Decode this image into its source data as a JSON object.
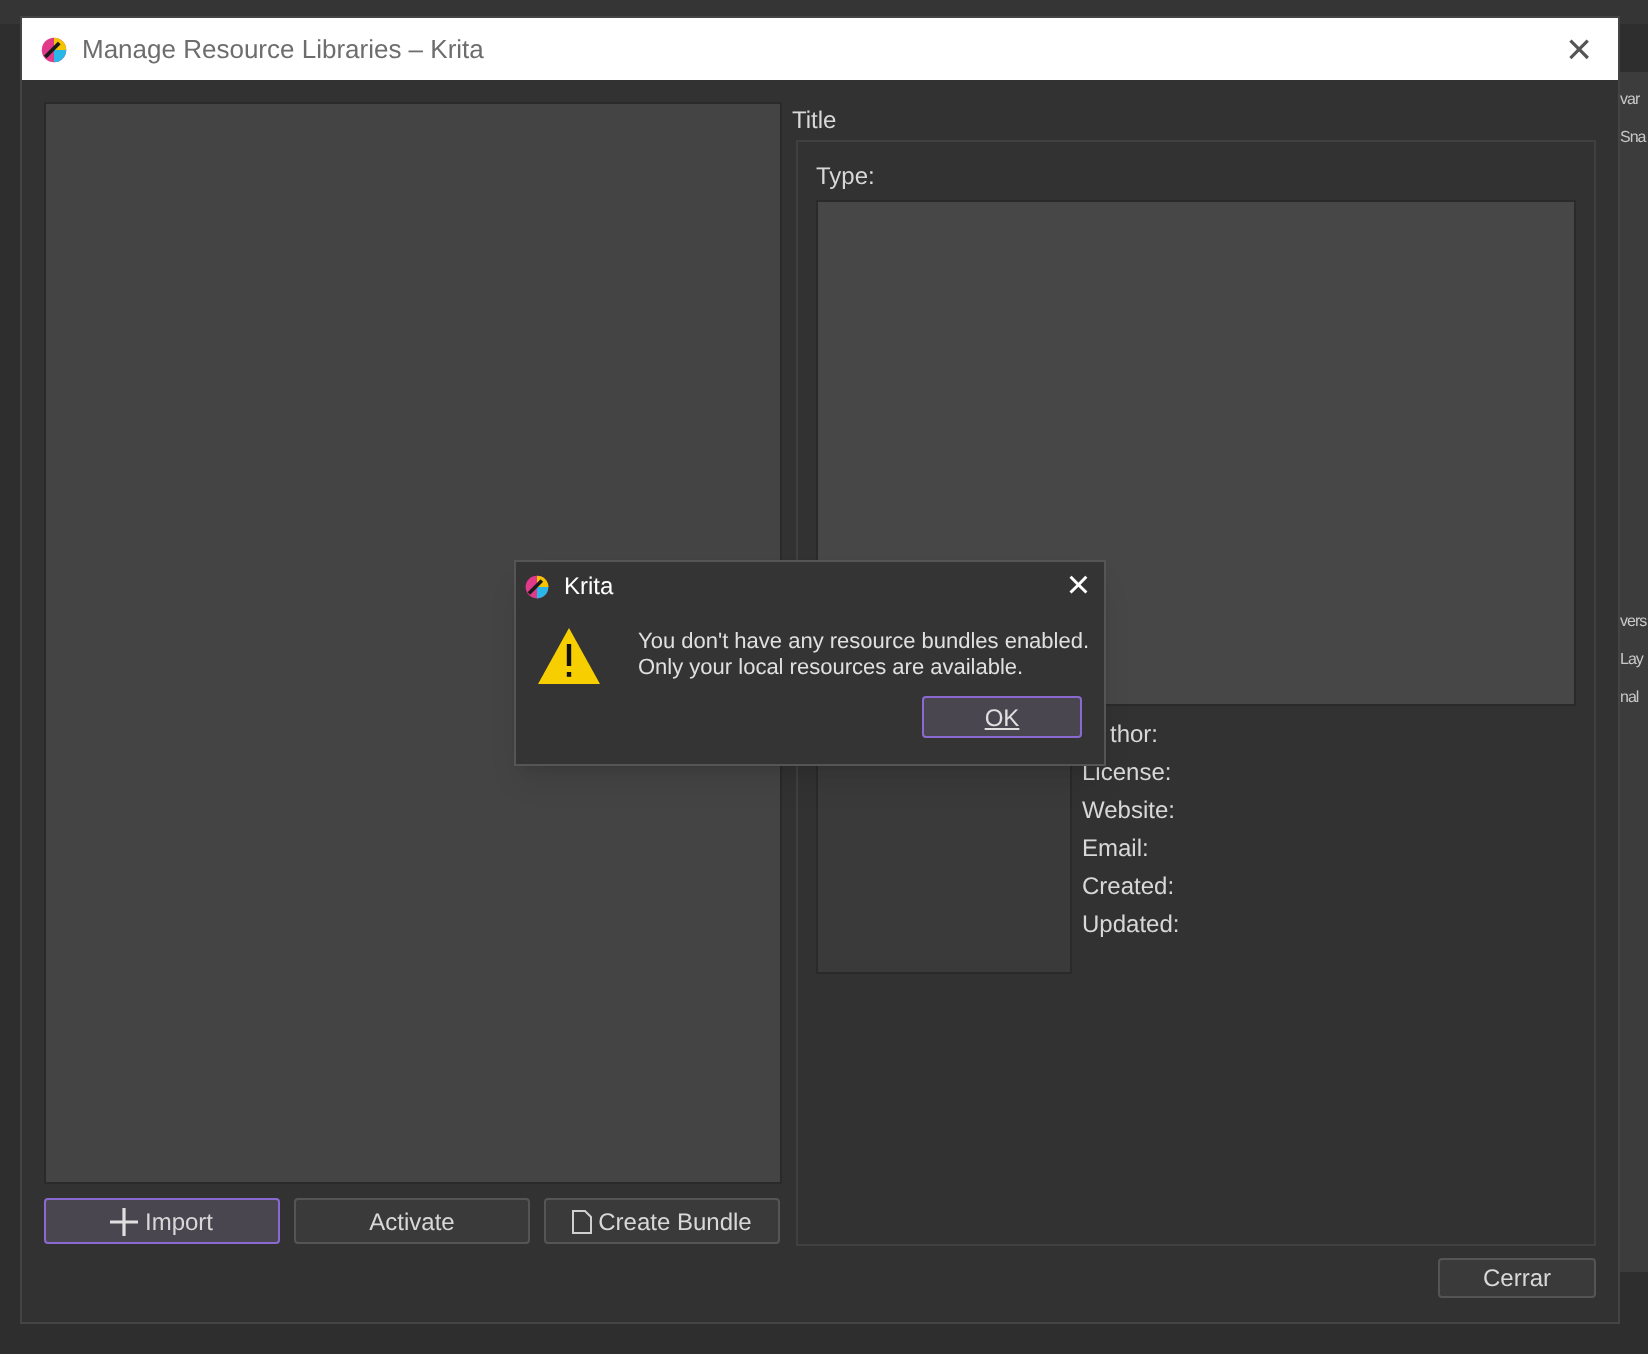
{
  "background_panel": {
    "fragments": [
      "var",
      "Sna",
      "vers",
      "Lay",
      "nal"
    ]
  },
  "window": {
    "title": "Manage Resource Libraries – Krita",
    "close": "×"
  },
  "details": {
    "title_label": "Title",
    "type_label": "Type:",
    "fields": [
      "thor:",
      "License:",
      "Website:",
      "Email:",
      "Created:",
      "Updated:"
    ]
  },
  "buttons": [
    {
      "label": "Import",
      "kind": "import",
      "selected": true
    },
    {
      "label": "Activate",
      "kind": "plain",
      "selected": false
    },
    {
      "label": "Create Bundle",
      "kind": "bundle",
      "selected": false
    }
  ],
  "close_button": "Cerrar",
  "message": {
    "title": "Krita",
    "close": "×",
    "lines": [
      "You don't have any resource bundles enabled.",
      "Only your local resources are available."
    ],
    "ok": "OK"
  }
}
